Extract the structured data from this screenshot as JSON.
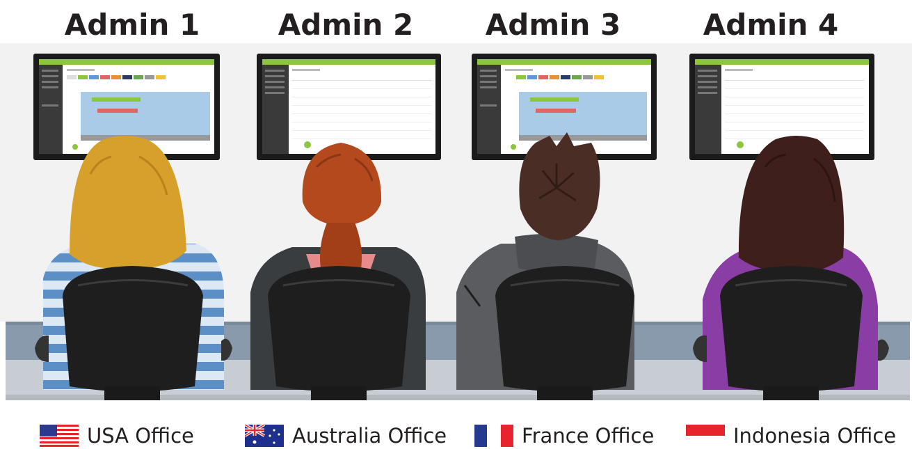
{
  "stations": [
    {
      "title": "Admin 1",
      "screen": "calendar",
      "hair": "#d7a02a",
      "top": "stripes"
    },
    {
      "title": "Admin 2",
      "screen": "table",
      "hair": "#b5491e",
      "top": "dark-pink"
    },
    {
      "title": "Admin 3",
      "screen": "calendar",
      "hair": "#4a2e25",
      "top": "hoodie"
    },
    {
      "title": "Admin 4",
      "screen": "table",
      "hair": "#3f1f1c",
      "top": "purple"
    }
  ],
  "offices": [
    {
      "label": "USA Office",
      "flag": "usa-flag-icon"
    },
    {
      "label": "Australia Office",
      "flag": "australia-flag-icon"
    },
    {
      "label": "France Office",
      "flag": "france-flag-icon"
    },
    {
      "label": "Indonesia Office",
      "flag": "indonesia-flag-icon"
    }
  ],
  "colors": {
    "desk": "#8a9aad",
    "wall": "#f2f2f2",
    "screen_header": "#8cc63f",
    "chair": "#1e1e1e"
  }
}
